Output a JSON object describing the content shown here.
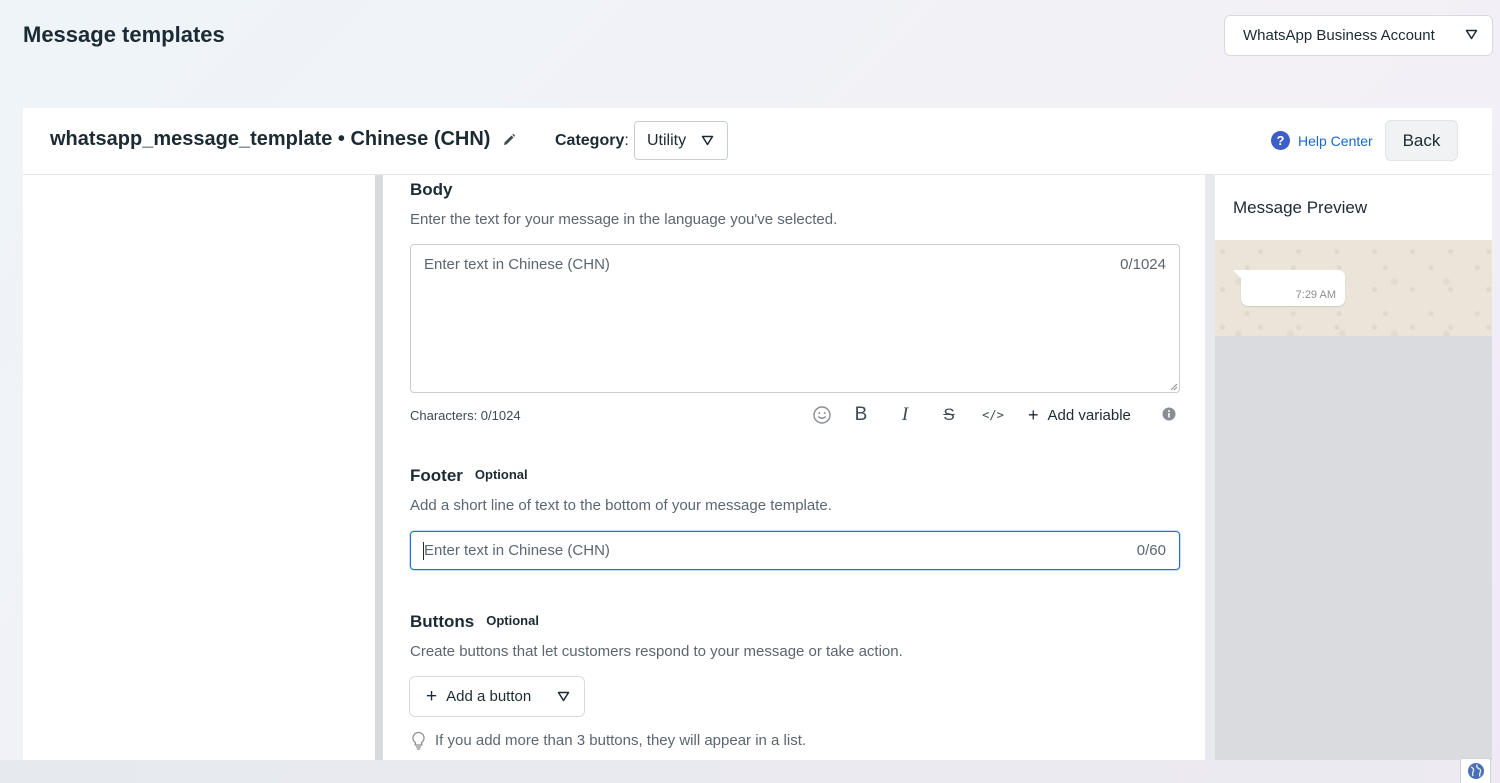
{
  "page": {
    "title": "Message templates"
  },
  "account_selector": {
    "label": "WhatsApp Business Account"
  },
  "template_header": {
    "name": "whatsapp_message_template • Chinese (CHN)",
    "category_label": "Category",
    "category_colon": ":",
    "category_value": "Utility",
    "help_center": "Help Center",
    "help_icon_glyph": "?",
    "back": "Back"
  },
  "body_section": {
    "title": "Body",
    "description": "Enter the text for your message in the language you've selected.",
    "placeholder": "Enter text in Chinese (CHN)",
    "counter": "0/1024",
    "characters": "Characters: 0/1024",
    "toolbar": {
      "bold_glyph": "B",
      "italic_glyph": "I",
      "strike_glyph": "S",
      "code_glyph": "</>",
      "add_variable": "Add variable"
    }
  },
  "footer_section": {
    "title": "Footer",
    "optional": "Optional",
    "description": "Add a short line of text to the bottom of your message template.",
    "placeholder": "Enter text in Chinese (CHN)",
    "counter": "0/60"
  },
  "buttons_section": {
    "title": "Buttons",
    "optional": "Optional",
    "description": "Create buttons that let customers respond to your message or take action.",
    "add_button": "Add a button",
    "tip": "If you add more than 3 buttons, they will appear in a list."
  },
  "preview": {
    "title": "Message Preview",
    "bubble_time": "7:29 AM"
  },
  "colors": {
    "accent_blue": "#1d6fe0",
    "help_icon": "#3d5ec6",
    "text_primary": "#1c2b33",
    "text_secondary": "#5b6670"
  }
}
